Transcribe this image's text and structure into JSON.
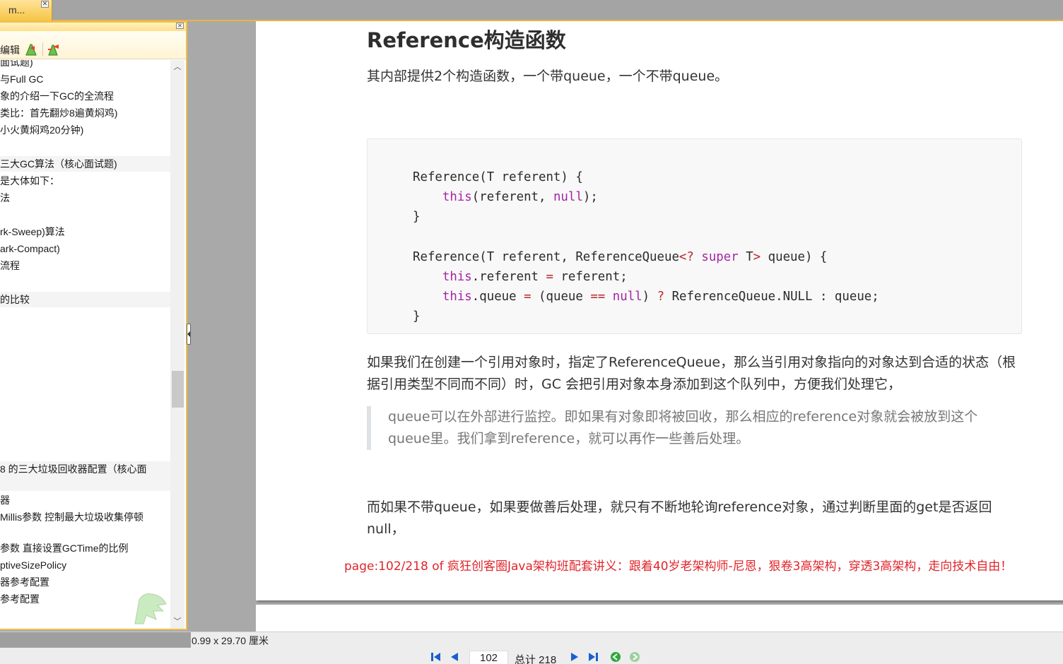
{
  "tabs": [
    {
      "label": "m..."
    }
  ],
  "side_panel": {
    "toolbar_label": "编辑",
    "items": [
      "面试题)",
      "  与Full GC",
      "象的介绍一下GC的全流程",
      "类比：首先翻炒8遍黄焖鸡)",
      "  小火黄焖鸡20分钟)",
      "",
      "三大GC算法（核心面试题)",
      "是大体如下：",
      "法",
      "",
      "rk-Sweep)算法",
      "ark-Compact)",
      "流程",
      "",
      "的比较",
      "8 的三大垃圾回收器配置（核心面",
      "",
      "器",
      "Millis参数  控制最大垃圾收集停顿",
      "",
      " 参数 直接设置GCTime的比例",
      "ptiveSizePolicy",
      "器参考配置",
      "参考配置"
    ]
  },
  "document": {
    "heading": "Reference构造函数",
    "intro": "其内部提供2个构造函数，一个带queue，一个不带queue。",
    "paragraph2": "如果我们在创建一个引用对象时，指定了ReferenceQueue，那么当引用对象指向的对象达到合适的状态（根据引用类型不同而不同）时，GC 会把引用对象本身添加到这个队列中，方便我们处理它，",
    "quote": "queue可以在外部进行监控。即如果有对象即将被回收，那么相应的reference对象就会被放到这个queue里。我们拿到reference，就可以再作一些善后处理。",
    "paragraph3": "而如果不带queue，如果要做善后处理，就只有不断地轮询reference对象，通过判断里面的get是否返回null，",
    "footer": "page:102/218 of   疯狂创客圈Java架构班配套讲义：跟着40岁老架构师-尼恩，狠卷3高架构，穿透3高架构，走向技术自由！"
  },
  "status": {
    "page_size": "0.99 x 29.70 厘米",
    "current_page": "102",
    "total_pages": "总计 218"
  },
  "colors": {
    "tab_accent": "#f6c444",
    "code_keyword": "#a626a4",
    "code_operator": "#b9272f",
    "footer_red": "#e0252b"
  }
}
